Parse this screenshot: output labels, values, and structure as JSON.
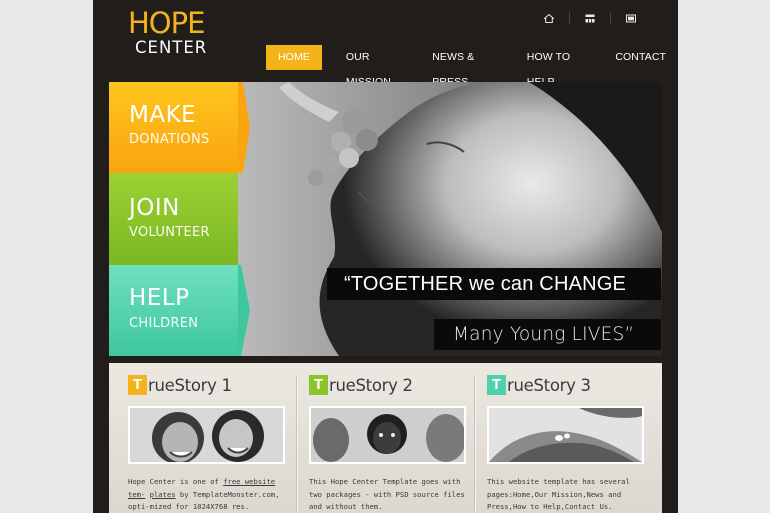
{
  "logo": {
    "line1": "HOPE",
    "line2": "CENTER"
  },
  "top_icons": [
    "home-icon",
    "sitemap-icon",
    "mail-icon"
  ],
  "nav": {
    "items": [
      "HOME",
      "OUR MISSION",
      "NEWS & PRESS",
      "HOW TO HELP",
      "CONTACT"
    ],
    "active_index": 0
  },
  "hero": {
    "panels": [
      {
        "title": "MAKE",
        "subtitle": "DONATIONS",
        "color": "#f9ae14"
      },
      {
        "title": "JOIN",
        "subtitle": "VOLUNTEER",
        "color": "#8cc52b"
      },
      {
        "title": "HELP",
        "subtitle": "CHILDREN",
        "color": "#4fd0aa"
      }
    ],
    "quote_line1": "“TOGETHER we can CHANGE",
    "quote_line2": "Many Young LIVES”"
  },
  "stories": [
    {
      "badge_letter": "T",
      "badge_color": "#f2b31b",
      "title": "rueStory 1",
      "text_a": "Hope Center is one of ",
      "link1": "free website tem-",
      "text_b": " ",
      "link2": "plates",
      "text_c": " by TemplateMonster.com, opti-mized for 1024X768 res."
    },
    {
      "badge_letter": "T",
      "badge_color": "#8cc52b",
      "title": "rueStory 2",
      "text": "This Hope Center Template goes with two packages - with PSD source files and without them."
    },
    {
      "badge_letter": "T",
      "badge_color": "#4fd0aa",
      "title": "rueStory 3",
      "text": "This website template has several pages:Home,Our Mission,News and Press,How to Help,Contact Us."
    }
  ]
}
